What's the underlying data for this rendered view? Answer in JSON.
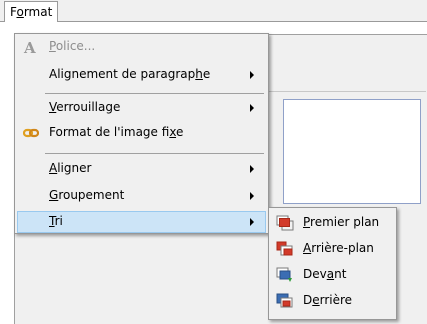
{
  "menubar": {
    "format_label_pre": "F",
    "format_label_ul": "o",
    "format_label_post": "rmat"
  },
  "menu": {
    "items": [
      {
        "pre": "",
        "ul": "P",
        "post": "olice...",
        "icon": "font-A-icon",
        "disabled": true,
        "submenu": false
      },
      {
        "pre": "Alignement de paragrap",
        "ul": "h",
        "post": "e",
        "icon": "",
        "disabled": false,
        "submenu": true
      },
      {
        "pre": "",
        "ul": "V",
        "post": "errouillage",
        "icon": "",
        "disabled": false,
        "submenu": true
      },
      {
        "pre": "Format de l'image fi",
        "ul": "x",
        "post": "e",
        "icon": "link-chain-icon",
        "disabled": false,
        "submenu": false
      },
      {
        "pre": "",
        "ul": "A",
        "post": "ligner",
        "icon": "",
        "disabled": false,
        "submenu": true
      },
      {
        "pre": "",
        "ul": "G",
        "post": "roupement",
        "icon": "",
        "disabled": false,
        "submenu": true
      },
      {
        "pre": "",
        "ul": "T",
        "post": "ri",
        "icon": "",
        "disabled": false,
        "submenu": true,
        "highlighted": true
      }
    ]
  },
  "submenu": {
    "items": [
      {
        "pre": "",
        "ul": "P",
        "post": "remier plan",
        "icon": "bring-to-front-icon"
      },
      {
        "pre": "",
        "ul": "A",
        "post": "rrière-plan",
        "icon": "send-to-back-icon"
      },
      {
        "pre": "Dev",
        "ul": "a",
        "post": "nt",
        "icon": "bring-forward-icon"
      },
      {
        "pre": "D",
        "ul": "e",
        "post": "rrière",
        "icon": "send-backward-icon"
      }
    ]
  },
  "colors": {
    "highlight_bg": "#cce4f7",
    "highlight_border": "#99c9ef",
    "menu_bg": "#f0f0f0",
    "icon_red": "#d23a2a",
    "icon_blue": "#3b6db3"
  }
}
